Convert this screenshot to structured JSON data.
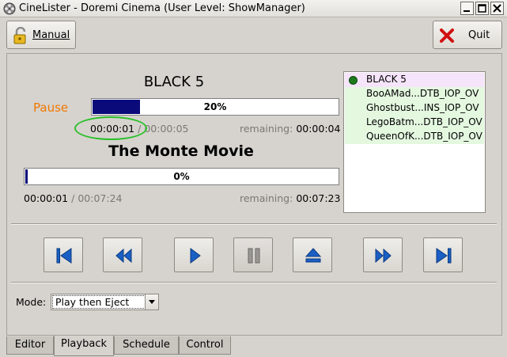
{
  "window": {
    "title": "CineLister - Doremi Cinema (User Level: ShowManager)"
  },
  "toolbar": {
    "manual_label": "Manual",
    "quit_label": "Quit"
  },
  "show": {
    "title": "BLACK 5",
    "state": "Pause",
    "progress_percent": 20,
    "progress_label": "20%",
    "elapsed": "00:00:01",
    "separator": "/",
    "total": "00:00:05",
    "remaining_label": "remaining:",
    "remaining": "00:00:04"
  },
  "movie": {
    "title": "The Monte Movie",
    "progress_percent": 0,
    "progress_label": "0%",
    "elapsed": "00:00:01",
    "separator": "/",
    "total": "00:07:24",
    "remaining_label": "remaining:",
    "remaining": "00:07:23"
  },
  "playlist": {
    "items": [
      {
        "label": "BLACK 5",
        "active": true
      },
      {
        "label": "BooAMad...DTB_IOP_OV"
      },
      {
        "label": "Ghostbust...INS_IOP_OV"
      },
      {
        "label": "LegoBatm...DTB_IOP_OV"
      },
      {
        "label": "QueenOfK...DTB_IOP_OV"
      }
    ]
  },
  "transport": {
    "buttons": [
      "skip-to-start",
      "rewind",
      "play",
      "pause",
      "eject",
      "fast-forward",
      "skip-to-end"
    ]
  },
  "mode": {
    "label": "Mode:",
    "value": "Play then Eject"
  },
  "tabs": [
    "Editor",
    "Playback",
    "Schedule",
    "Control"
  ],
  "active_tab": "Playback",
  "colors": {
    "state_pause": "#f07800",
    "progress_fill": "#0a0a7a",
    "playlist_active": "#f6e4fa",
    "playlist_item": "#e4f8e0",
    "transport_icon": "#1a5fc4",
    "highlight": "#2bbf2b"
  }
}
